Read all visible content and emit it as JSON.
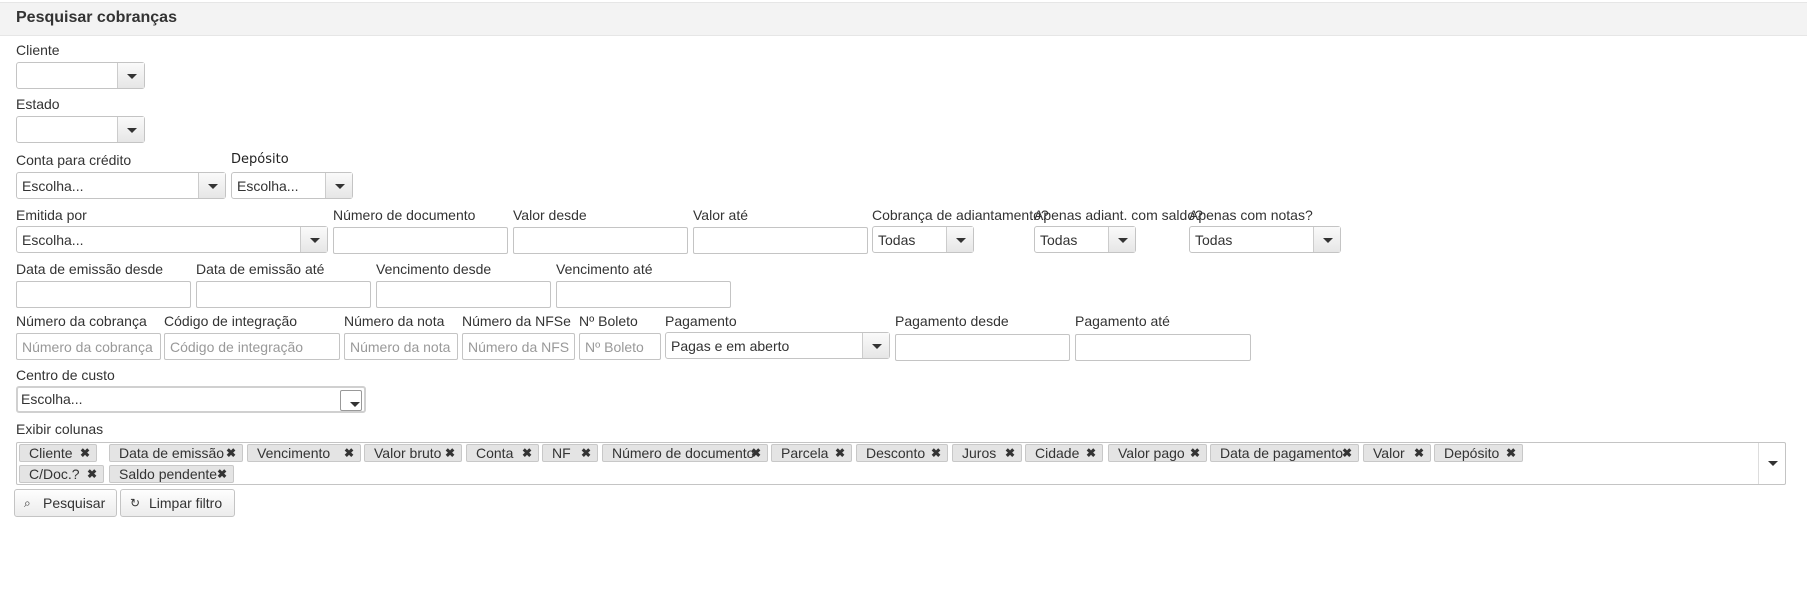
{
  "header": {
    "title": "Pesquisar cobranças"
  },
  "labels": {
    "cliente": "Cliente",
    "estado": "Estado",
    "conta_credito": "Conta para crédito",
    "deposito": "Depósito",
    "emitida_por": "Emitida por",
    "numero_documento": "Número de documento",
    "valor_desde": "Valor desde",
    "valor_ate": "Valor até",
    "cobranca_adiantamento": "Cobrança de adiantamento?",
    "apenas_adiant": "Apenas adiant. com saldo?",
    "apenas_notas": "Apenas com notas?",
    "data_emissao_desde": "Data de emissão desde",
    "data_emissao_ate": "Data de emissão até",
    "vencimento_desde": "Vencimento desde",
    "vencimento_ate": "Vencimento até",
    "numero_cobranca": "Número da cobrança",
    "codigo_integracao": "Código de integração",
    "numero_nota": "Número da nota",
    "numero_nfse": "Número da NFSe",
    "n_boleto": "Nº Boleto",
    "pagamento": "Pagamento",
    "pagamento_desde": "Pagamento desde",
    "pagamento_ate": "Pagamento até",
    "centro_custo": "Centro de custo",
    "exibir_colunas": "Exibir colunas"
  },
  "selects": {
    "cliente": "",
    "estado": "",
    "conta_credito": "Escolha...",
    "deposito": "Escolha...",
    "emitida_por": "Escolha...",
    "cobranca_adiantamento": "Todas",
    "apenas_adiant": "Todas",
    "apenas_notas": "Todas",
    "pagamento": "Pagas e em aberto",
    "centro_custo": "Escolha..."
  },
  "placeholders": {
    "numero_cobranca": "Número da cobrança",
    "codigo_integracao": "Código de integração",
    "numero_nota": "Número da nota",
    "numero_nfse": "Número da NFSe",
    "n_boleto": "Nº Boleto"
  },
  "columns": [
    "Cliente",
    "Data de emissão",
    "Vencimento",
    "Valor bruto",
    "Conta",
    "NF",
    "Número de documento",
    "Parcela",
    "Desconto",
    "Juros",
    "Cidade",
    "Valor pago",
    "Data de pagamento",
    "Valor",
    "Depósito",
    "C/Doc.?",
    "Saldo pendente"
  ],
  "buttons": {
    "pesquisar": "Pesquisar",
    "limpar": "Limpar filtro"
  }
}
